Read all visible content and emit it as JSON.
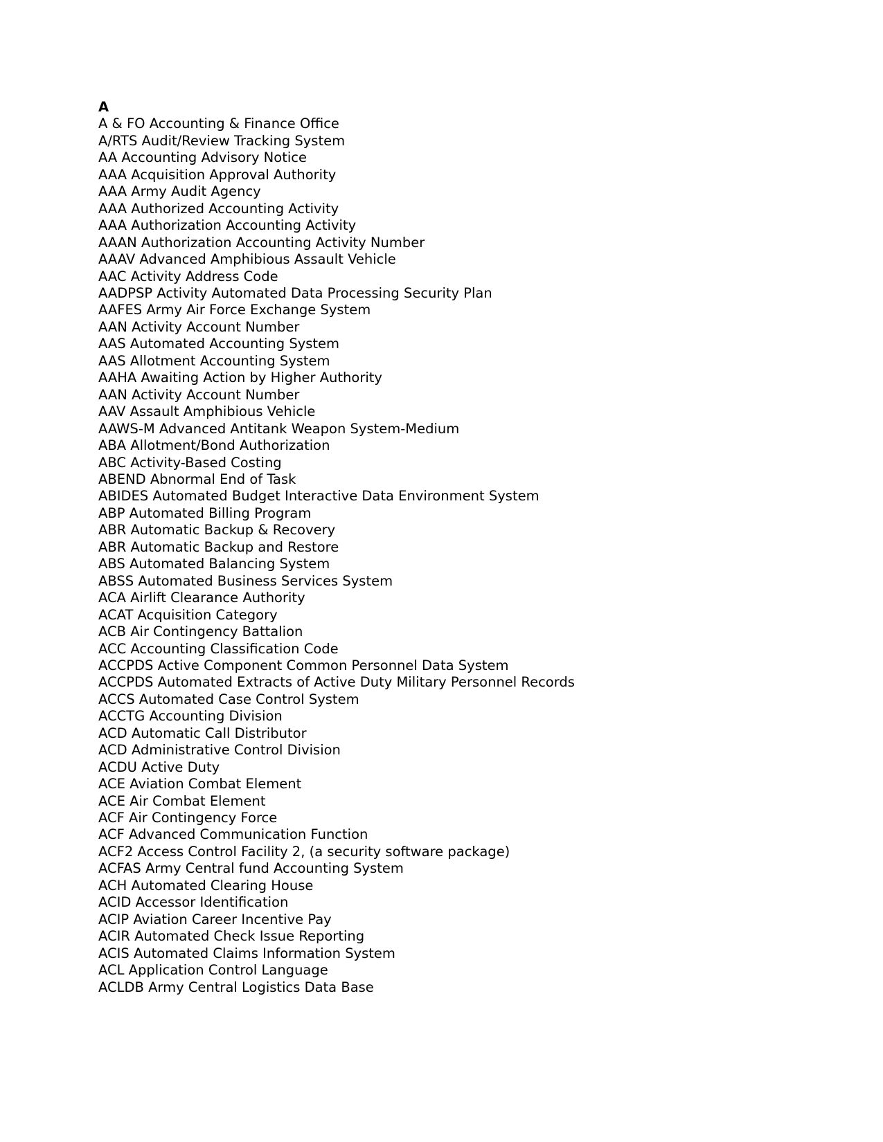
{
  "document": {
    "section_heading": "A",
    "entries": [
      "A & FO Accounting & Finance Office",
      "A/RTS Audit/Review Tracking System",
      "AA Accounting Advisory Notice",
      "AAA Acquisition Approval Authority",
      "AAA Army Audit Agency",
      "AAA Authorized Accounting Activity",
      "AAA Authorization Accounting Activity",
      "AAAN Authorization Accounting Activity Number",
      "AAAV Advanced Amphibious Assault Vehicle",
      "AAC Activity Address Code",
      "AADPSP Activity Automated Data Processing Security Plan",
      "AAFES Army Air Force Exchange System",
      "AAN Activity Account Number",
      "AAS Automated Accounting System",
      "AAS Allotment Accounting System",
      "AAHA Awaiting Action by Higher Authority",
      "AAN Activity Account Number",
      "AAV Assault Amphibious Vehicle",
      "AAWS-M Advanced Antitank Weapon System-Medium",
      "ABA Allotment/Bond Authorization",
      "ABC Activity-Based Costing",
      "ABEND Abnormal End of Task",
      "ABIDES Automated Budget Interactive Data Environment System",
      "ABP Automated Billing Program",
      "ABR Automatic Backup & Recovery",
      "ABR Automatic Backup and Restore",
      "ABS Automated Balancing System",
      "ABSS Automated Business Services System",
      "ACA Airlift Clearance Authority",
      "ACAT Acquisition Category",
      "ACB Air Contingency Battalion",
      "ACC Accounting Classification Code",
      "ACCPDS Active Component Common Personnel Data System",
      "ACCPDS Automated Extracts of Active Duty Military Personnel Records",
      "ACCS Automated Case Control System",
      "ACCTG Accounting Division",
      "ACD Automatic Call Distributor",
      "ACD Administrative Control Division",
      "ACDU Active Duty",
      "ACE Aviation Combat Element",
      "ACE Air Combat Element",
      "ACF Air Contingency Force",
      "ACF Advanced Communication Function",
      "ACF2 Access Control Facility 2, (a security software package)",
      "ACFAS Army Central fund Accounting System",
      "ACH Automated Clearing House",
      "ACID Accessor Identification",
      "ACIP Aviation Career Incentive Pay",
      "ACIR Automated Check Issue Reporting",
      "ACIS Automated Claims Information System",
      "ACL Application Control Language",
      "ACLDB Army Central Logistics Data Base"
    ]
  }
}
